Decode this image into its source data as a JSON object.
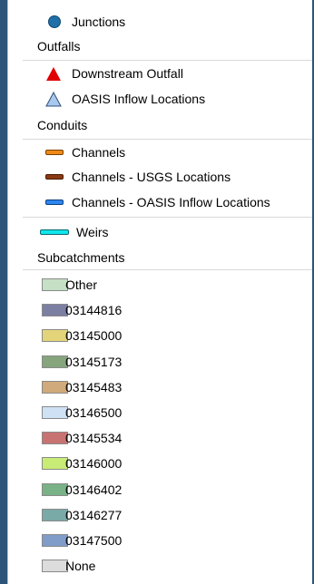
{
  "legend": {
    "junctions": {
      "label": "Junctions",
      "color": "#1f6fa8"
    },
    "outfalls": {
      "heading": "Outfalls",
      "items": [
        {
          "label": "Downstream Outfall",
          "color": "#e00000"
        },
        {
          "label": "OASIS Inflow Locations",
          "color": "#a9c8ee"
        }
      ]
    },
    "conduits": {
      "heading": "Conduits",
      "items": [
        {
          "label": "Channels",
          "color": "#ef8a17"
        },
        {
          "label": "Channels - USGS Locations",
          "color": "#8a3a12"
        },
        {
          "label": "Channels - OASIS Inflow Locations",
          "color": "#2e86f0"
        }
      ]
    },
    "weirs": {
      "label": "Weirs",
      "color": "#12e6ec"
    },
    "subcatchments": {
      "heading": "Subcatchments",
      "items": [
        {
          "label": "Other",
          "color": "#c5e0c4"
        },
        {
          "label": "03144816",
          "color": "#7b7fa2"
        },
        {
          "label": "03145000",
          "color": "#e3d47a"
        },
        {
          "label": "03145173",
          "color": "#86a57c"
        },
        {
          "label": "03145483",
          "color": "#d0aa7a"
        },
        {
          "label": "03146500",
          "color": "#cfe1f5"
        },
        {
          "label": "03145534",
          "color": "#c97272"
        },
        {
          "label": "03146000",
          "color": "#c8ec76"
        },
        {
          "label": "03146402",
          "color": "#78b286"
        },
        {
          "label": "03146277",
          "color": "#7aaaa7"
        },
        {
          "label": "03147500",
          "color": "#7f9dc8"
        },
        {
          "label": "None",
          "color": "#dcdcdc"
        }
      ]
    }
  }
}
